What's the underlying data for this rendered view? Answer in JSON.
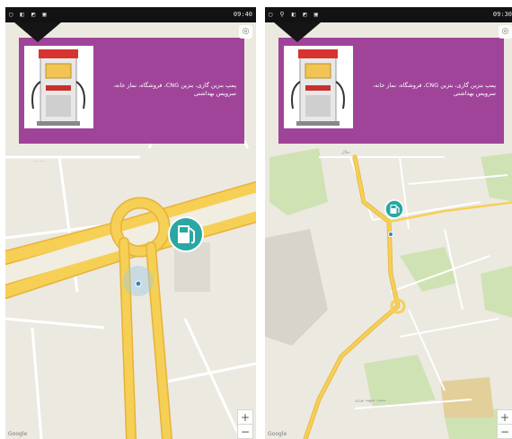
{
  "status_bar": {
    "left": {
      "time": "09:40",
      "icons_text": "▢ ◧ ◩ ▣"
    },
    "right": {
      "time": "09:30",
      "icons_text": "▢ ⚲ ◧ ◩ ▣"
    }
  },
  "banner": {
    "text": "پمپ بنزین گازی، بنزین CNG، فروشگاه، نماز خانه، سرویس بهداشتی",
    "background_color": "#a0449a"
  },
  "icons": {
    "menu": "menu-notch-icon",
    "locate": "target-icon",
    "marker": "fuel-pump-icon",
    "user_location": "user-location-icon"
  },
  "controls": {
    "zoom_in_label": "+",
    "zoom_out_label": "−",
    "locate_glyph": "◎"
  },
  "attribution": "Google",
  "labels": {
    "right_top": "جلال",
    "right_bottom": "سعید شهید نوری"
  },
  "colors": {
    "road_major": "#f6cf55",
    "road_edge": "#e6b23a",
    "map_bg": "#ece9e1",
    "park": "#cfe2b4",
    "marker": "#2aa7a2"
  }
}
